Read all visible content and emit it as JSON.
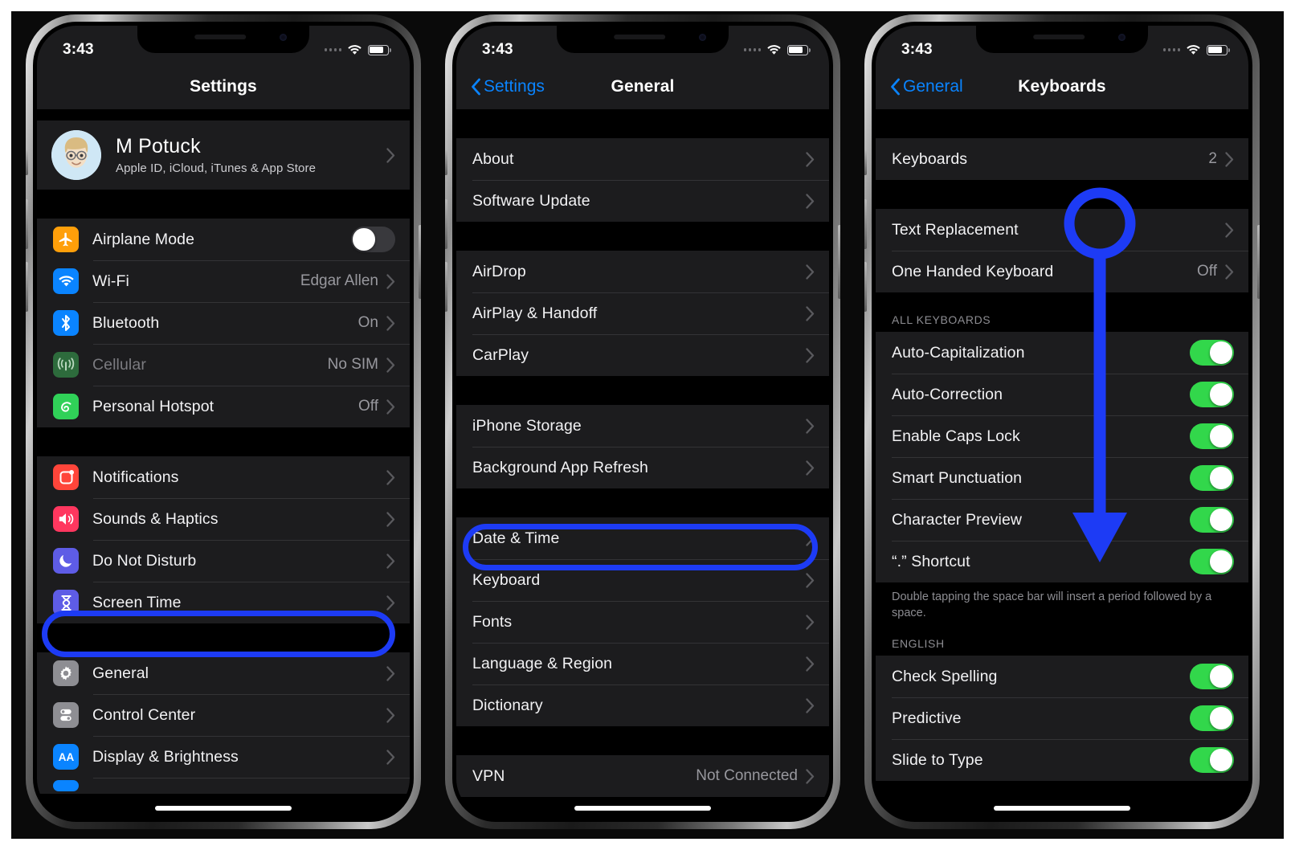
{
  "status_bar": {
    "time": "3:43",
    "wifi_icon": "wifi-icon",
    "battery_icon": "battery-icon",
    "signal_icon": "signal-dots-icon"
  },
  "phone1": {
    "nav": {
      "title": "Settings",
      "back_label": ""
    },
    "account": {
      "name": "M Potuck",
      "subtitle": "Apple ID, iCloud, iTunes & App Store",
      "avatar_name": "memoji-avatar"
    },
    "group_connectivity": [
      {
        "label": "Airplane Mode",
        "icon": "airplane-icon",
        "icon_color": "#ff9f0a",
        "control": "toggle",
        "toggle_on": false
      },
      {
        "label": "Wi-Fi",
        "icon": "wifi-icon",
        "icon_color": "#0a84ff",
        "value": "Edgar Allen",
        "control": "chevron"
      },
      {
        "label": "Bluetooth",
        "icon": "bluetooth-icon",
        "icon_color": "#0a84ff",
        "value": "On",
        "control": "chevron"
      },
      {
        "label": "Cellular",
        "icon": "cellular-icon",
        "icon_color": "#30d158",
        "value": "No SIM",
        "control": "chevron",
        "dimmed": true
      },
      {
        "label": "Personal Hotspot",
        "icon": "hotspot-icon",
        "icon_color": "#30d158",
        "value": "Off",
        "control": "chevron"
      }
    ],
    "group_alerts": [
      {
        "label": "Notifications",
        "icon": "notifications-icon",
        "icon_color": "#ff3b30",
        "control": "chevron"
      },
      {
        "label": "Sounds & Haptics",
        "icon": "sounds-icon",
        "icon_color": "#ff2d55",
        "control": "chevron"
      },
      {
        "label": "Do Not Disturb",
        "icon": "moon-icon",
        "icon_color": "#5e5ce6",
        "control": "chevron"
      },
      {
        "label": "Screen Time",
        "icon": "hourglass-icon",
        "icon_color": "#5e5ce6",
        "control": "chevron"
      }
    ],
    "group_system": [
      {
        "label": "General",
        "icon": "gear-icon",
        "icon_color": "#8e8e93",
        "control": "chevron",
        "highlighted": true
      },
      {
        "label": "Control Center",
        "icon": "control-center-icon",
        "icon_color": "#8e8e93",
        "control": "chevron"
      },
      {
        "label": "Display & Brightness",
        "icon": "display-brightness-icon",
        "icon_color": "#0a84ff",
        "control": "chevron"
      }
    ]
  },
  "phone2": {
    "nav": {
      "title": "General",
      "back_label": "Settings"
    },
    "group_a": [
      {
        "label": "About",
        "control": "chevron"
      },
      {
        "label": "Software Update",
        "control": "chevron"
      }
    ],
    "group_b": [
      {
        "label": "AirDrop",
        "control": "chevron"
      },
      {
        "label": "AirPlay & Handoff",
        "control": "chevron"
      },
      {
        "label": "CarPlay",
        "control": "chevron"
      }
    ],
    "group_c": [
      {
        "label": "iPhone Storage",
        "control": "chevron"
      },
      {
        "label": "Background App Refresh",
        "control": "chevron"
      }
    ],
    "group_d": [
      {
        "label": "Date & Time",
        "control": "chevron"
      },
      {
        "label": "Keyboard",
        "control": "chevron",
        "highlighted": true
      },
      {
        "label": "Fonts",
        "control": "chevron"
      },
      {
        "label": "Language & Region",
        "control": "chevron"
      },
      {
        "label": "Dictionary",
        "control": "chevron"
      }
    ],
    "group_e": [
      {
        "label": "VPN",
        "value": "Not Connected",
        "control": "chevron"
      }
    ]
  },
  "phone3": {
    "nav": {
      "title": "Keyboards",
      "back_label": "General"
    },
    "group_a": [
      {
        "label": "Keyboards",
        "value": "2",
        "control": "chevron"
      }
    ],
    "group_b": [
      {
        "label": "Text Replacement",
        "control": "chevron"
      },
      {
        "label": "One Handed Keyboard",
        "value": "Off",
        "control": "chevron",
        "annotated": true
      }
    ],
    "all_keyboards_header": "ALL KEYBOARDS",
    "group_all": [
      {
        "label": "Auto-Capitalization",
        "control": "toggle",
        "toggle_on": true
      },
      {
        "label": "Auto-Correction",
        "control": "toggle",
        "toggle_on": true
      },
      {
        "label": "Enable Caps Lock",
        "control": "toggle",
        "toggle_on": true
      },
      {
        "label": "Smart Punctuation",
        "control": "toggle",
        "toggle_on": true
      },
      {
        "label": "Character Preview",
        "control": "toggle",
        "toggle_on": true
      },
      {
        "label": "“.” Shortcut",
        "control": "toggle",
        "toggle_on": true
      }
    ],
    "footer_text": "Double tapping the space bar will insert a period followed by a space.",
    "english_header": "ENGLISH",
    "group_english": [
      {
        "label": "Check Spelling",
        "control": "toggle",
        "toggle_on": true
      },
      {
        "label": "Predictive",
        "control": "toggle",
        "toggle_on": true
      },
      {
        "label": "Slide to Type",
        "control": "toggle",
        "toggle_on": true
      }
    ]
  },
  "annotations": {
    "accent_color": "#1d3bf5",
    "highlight_general": "General",
    "highlight_keyboard": "Keyboard",
    "arrow_target": "“.” Shortcut"
  },
  "colors": {
    "screen_bg": "#000000",
    "group_bg": "#1c1c1e",
    "separator": "#333336",
    "primary_text": "#f2f2f4",
    "secondary_text": "#98989e",
    "tint_blue": "#0a84ff",
    "toggle_green": "#32d74b"
  }
}
